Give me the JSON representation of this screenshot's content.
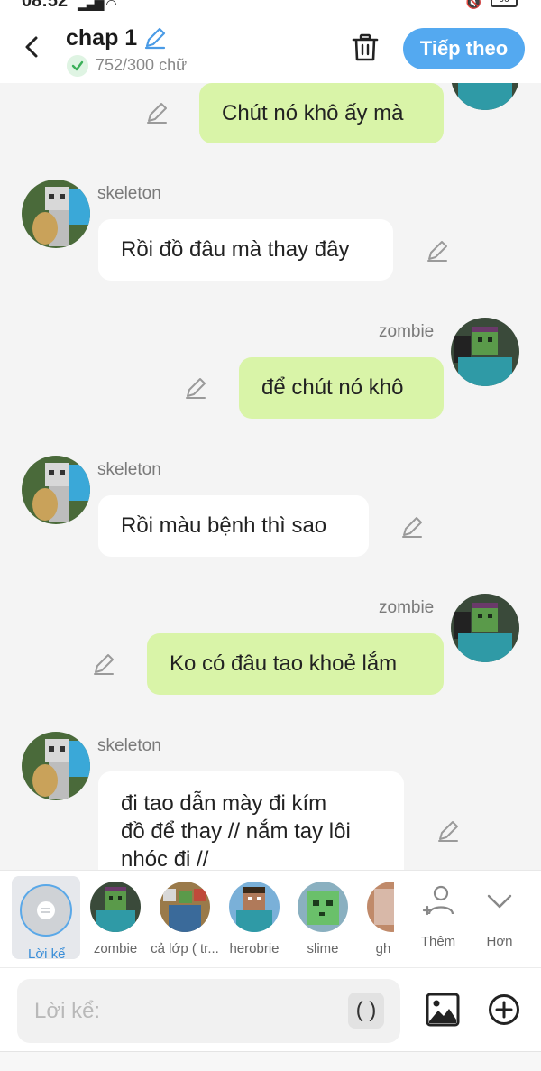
{
  "status": {
    "time": "08:52",
    "battery": "96"
  },
  "header": {
    "title": "chap 1",
    "word_count": "752/300 chữ",
    "next_label": "Tiếp theo",
    "accent": "#54a9f0"
  },
  "messages": [
    {
      "speaker": "zombie",
      "side": "right",
      "text": "Chút nó khô ấy mà",
      "show_name": false
    },
    {
      "speaker": "skeleton",
      "side": "left",
      "text": "Rồi đồ đâu mà thay đây",
      "show_name": true
    },
    {
      "speaker": "zombie",
      "side": "right",
      "text": "để chút nó khô",
      "show_name": true
    },
    {
      "speaker": "skeleton",
      "side": "left",
      "text": "Rồi màu bệnh thì sao",
      "show_name": true
    },
    {
      "speaker": "zombie",
      "side": "right",
      "text": "Ko có đâu tao khoẻ lắm",
      "show_name": true
    },
    {
      "speaker": "skeleton",
      "side": "left",
      "text_lines": [
        "đi tao dẫn mày đi kím",
        "đồ để thay // nắm tay lôi",
        "nhóc đi //"
      ],
      "show_name": true
    }
  ],
  "characters": {
    "narrator_label": "Lời kể",
    "items": [
      "zombie",
      "cả lớp ( tr...",
      "herobrie",
      "slime",
      "gh"
    ],
    "add_label": "Thêm",
    "more_label": "Hơn"
  },
  "composer": {
    "placeholder": "Lời kể:",
    "paren_label": "( )"
  },
  "colors": {
    "bubble_left": "#ffffff",
    "bubble_right": "#d9f4a8",
    "background": "#f4f4f4"
  },
  "icons": [
    "back-arrow-icon",
    "pencil-icon",
    "check-icon",
    "trash-icon",
    "image-icon",
    "plus-circle-icon",
    "person-add-icon",
    "chevron-down-icon"
  ]
}
